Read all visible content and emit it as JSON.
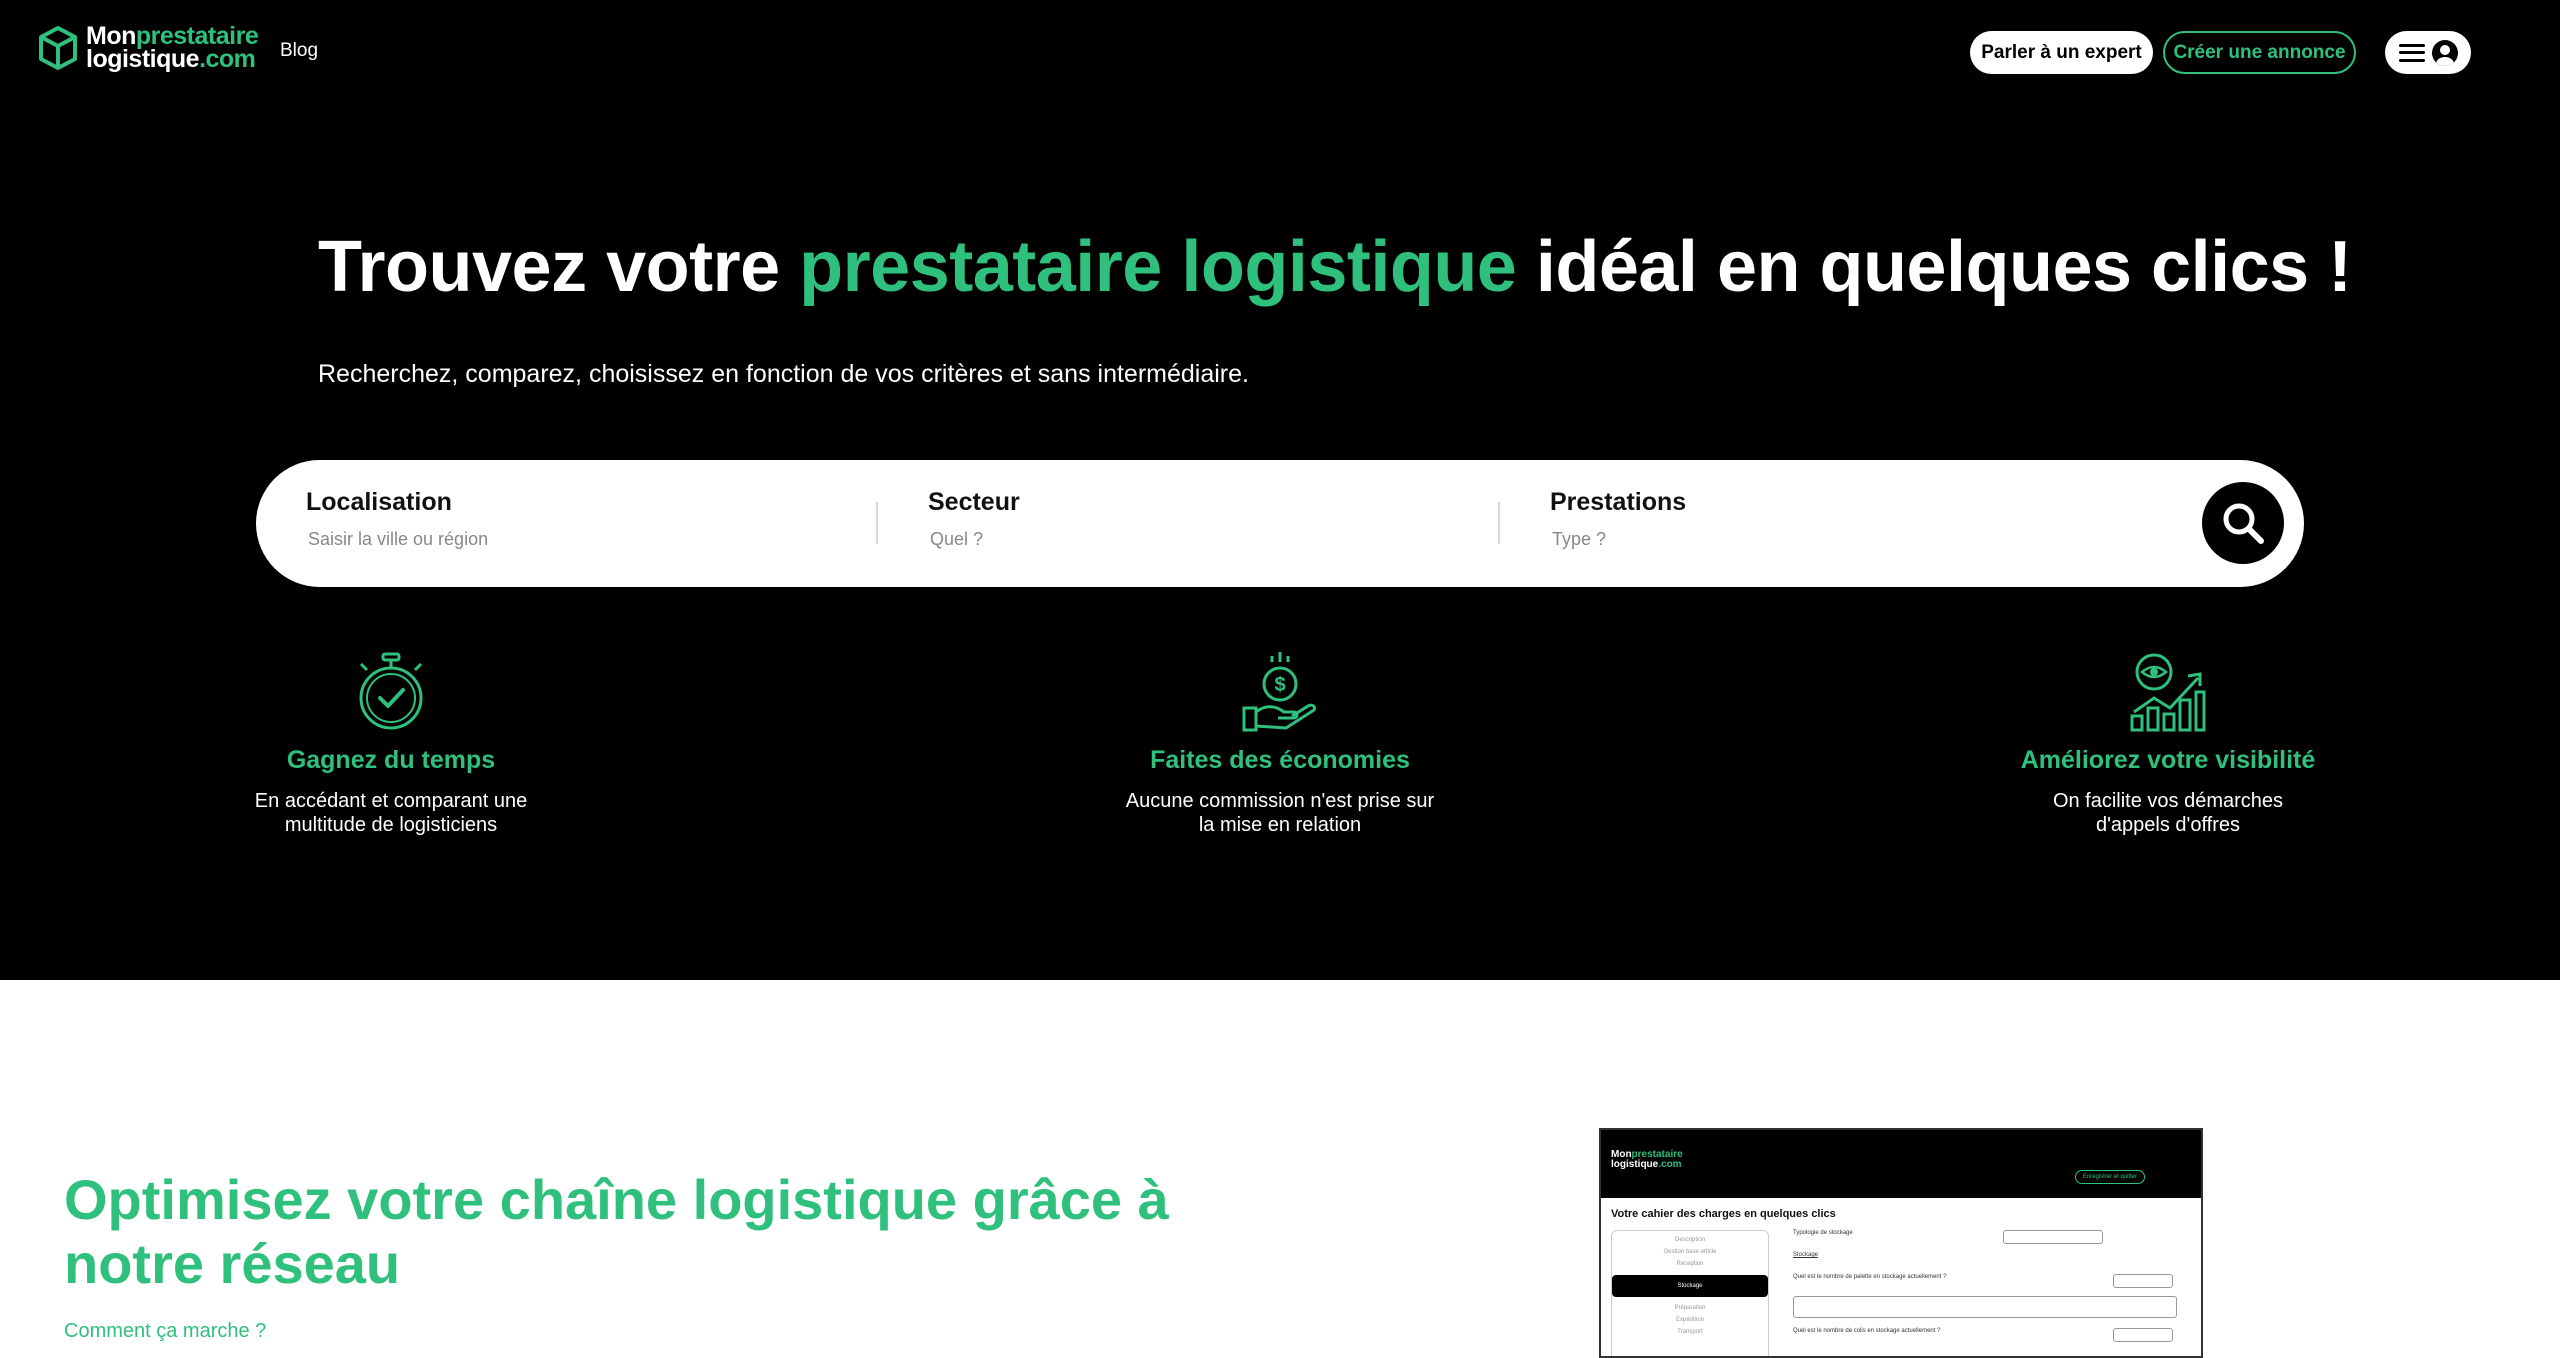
{
  "header": {
    "logo": {
      "line1_white": "Mon",
      "line1_green": "prestataire",
      "line2_white": "logistique",
      "line2_green": ".com"
    },
    "nav_blog": "Blog",
    "btn_expert": "Parler à un expert",
    "btn_annonce": "Créer une annonce"
  },
  "hero": {
    "title_pre": "Trouvez votre ",
    "title_highlight": "prestataire logistique",
    "title_post": " idéal en quelques clics !",
    "subtitle": "Recherchez, comparez, choisissez en fonction de vos critères et sans intermédiaire."
  },
  "search": {
    "fields": [
      {
        "label": "Localisation",
        "placeholder": "Saisir la ville ou région"
      },
      {
        "label": "Secteur",
        "placeholder": "Quel ?"
      },
      {
        "label": "Prestations",
        "placeholder": "Type ?"
      }
    ]
  },
  "features": [
    {
      "icon": "stopwatch-check-icon",
      "title": "Gagnez du temps",
      "desc_l1": "En accédant et comparant une",
      "desc_l2": "multitude de logisticiens"
    },
    {
      "icon": "hand-coin-icon",
      "title": "Faites des économies",
      "desc_l1": "Aucune commission n'est prise sur",
      "desc_l2": "la mise en relation"
    },
    {
      "icon": "chart-eye-icon",
      "title": "Améliorez votre visibilité",
      "desc_l1": "On facilite vos démarches",
      "desc_l2": "d'appels d'offres"
    }
  ],
  "section": {
    "title": "Optimisez votre chaîne logistique grâce à notre réseau",
    "link": "Comment ça marche ?"
  },
  "preview": {
    "logo_l1w": "Mon",
    "logo_l1g": "prestataire",
    "logo_l2w": "logistique",
    "logo_l2g": ".com",
    "save_btn": "Enregistrer et quitter",
    "title": "Votre cahier des charges en quelques clics",
    "menu": [
      "Description",
      "Gestion base article",
      "Réception",
      "Stockage",
      "Préparation",
      "Expédition",
      "Transport"
    ],
    "form_rows": [
      "Typologie de stockage",
      "Stockage",
      "Quel est le nombre de palette en stockage actuellement ?",
      "Quel est le nombre de colis en stockage actuellement ?"
    ]
  },
  "colors": {
    "accent": "#2fc07d",
    "background_dark": "#000000"
  }
}
